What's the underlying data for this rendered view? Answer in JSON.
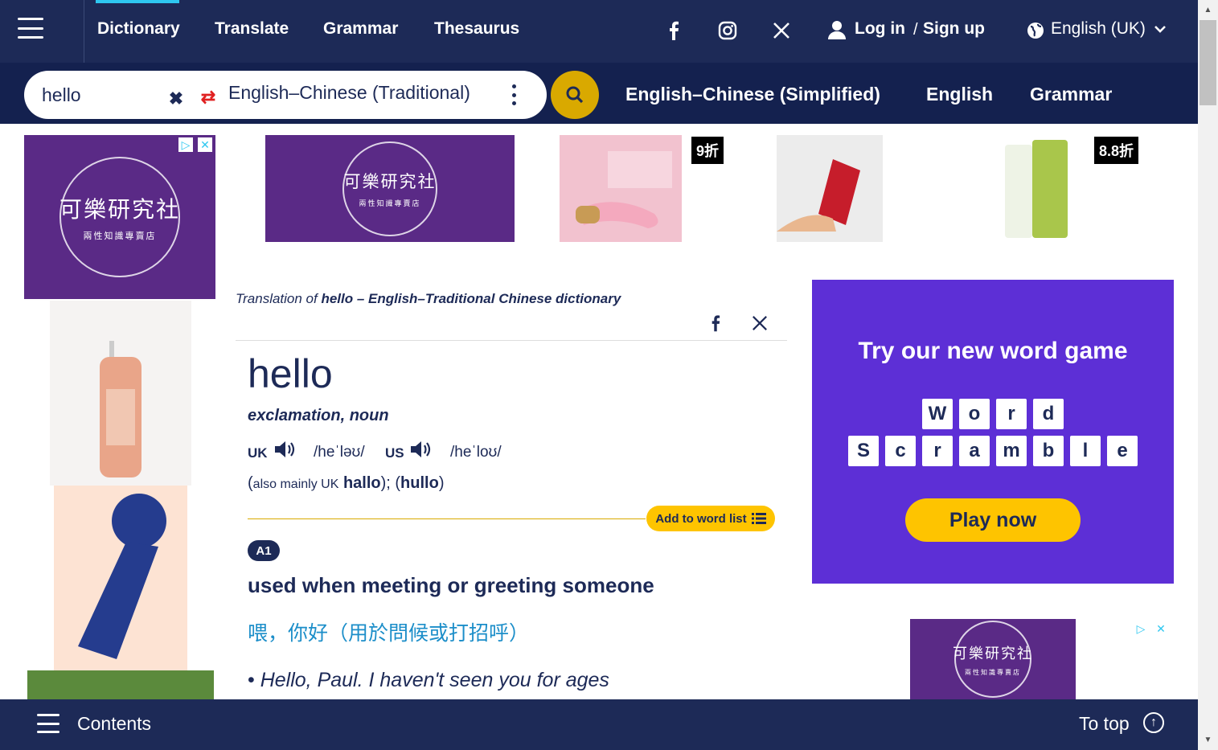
{
  "nav": {
    "links": [
      "Dictionary",
      "Translate",
      "Grammar",
      "Thesaurus"
    ],
    "login": "Log in",
    "slash": "/",
    "signup": "Sign up",
    "language": "English (UK)",
    "social": {
      "facebook": "f",
      "x": "𝕏"
    }
  },
  "search": {
    "value": "hello",
    "clear_icon": "✖",
    "swap_icon": "⇄",
    "dictionary": "English–Chinese (Traditional)",
    "quick_links": [
      "English–Chinese (Simplified)",
      "English",
      "Grammar"
    ]
  },
  "ads": {
    "brand": "可樂研究社",
    "brand_sub": "兩性知識專賣店",
    "discount1": "9折",
    "discount2": "8.8折",
    "game_title": "Try our new word game",
    "game_word1": [
      "W",
      "o",
      "r",
      "d"
    ],
    "game_word2": [
      "S",
      "c",
      "r",
      "a",
      "m",
      "b",
      "l",
      "e"
    ],
    "game_cta": "Play now"
  },
  "entry": {
    "caption_prefix": "Translation of ",
    "caption_word": "hello",
    "caption_suffix": " – English–Traditional Chinese dictionary",
    "headword": "hello",
    "pos": "exclamation, noun",
    "uk_label": "UK",
    "uk_pron": "/heˈləʊ/",
    "us_label": "US",
    "us_pron": "/heˈloʊ/",
    "also_open": "(",
    "also_text": "also mainly UK",
    "also_word1": "hallo",
    "also_mid": "); (",
    "also_word2": "hullo",
    "also_close": ")",
    "wordlist_label": "Add to word list",
    "level": "A1",
    "def_before": "used when ",
    "def_word1": "meeting",
    "def_or": " or ",
    "def_word2": "greeting",
    "def_after": " someone",
    "trans_word1": "喂",
    "trans_sep": "，",
    "trans_word2": "你好",
    "trans_rest": "（用於問候或打招呼）",
    "example_bullet": "• ",
    "example_before": "Hello, Paul. I haven't ",
    "example_word1": "seen",
    "example_mid": " you for ",
    "example_word2": "ages"
  },
  "footer": {
    "contents": "Contents",
    "to_top": "To top"
  },
  "colors": {
    "navy": "#1d2a57",
    "accent_yellow": "#fec400",
    "game_purple": "#5d2fd6",
    "ad_purple": "#5a2a86",
    "translation_blue": "#1c8ec9"
  }
}
